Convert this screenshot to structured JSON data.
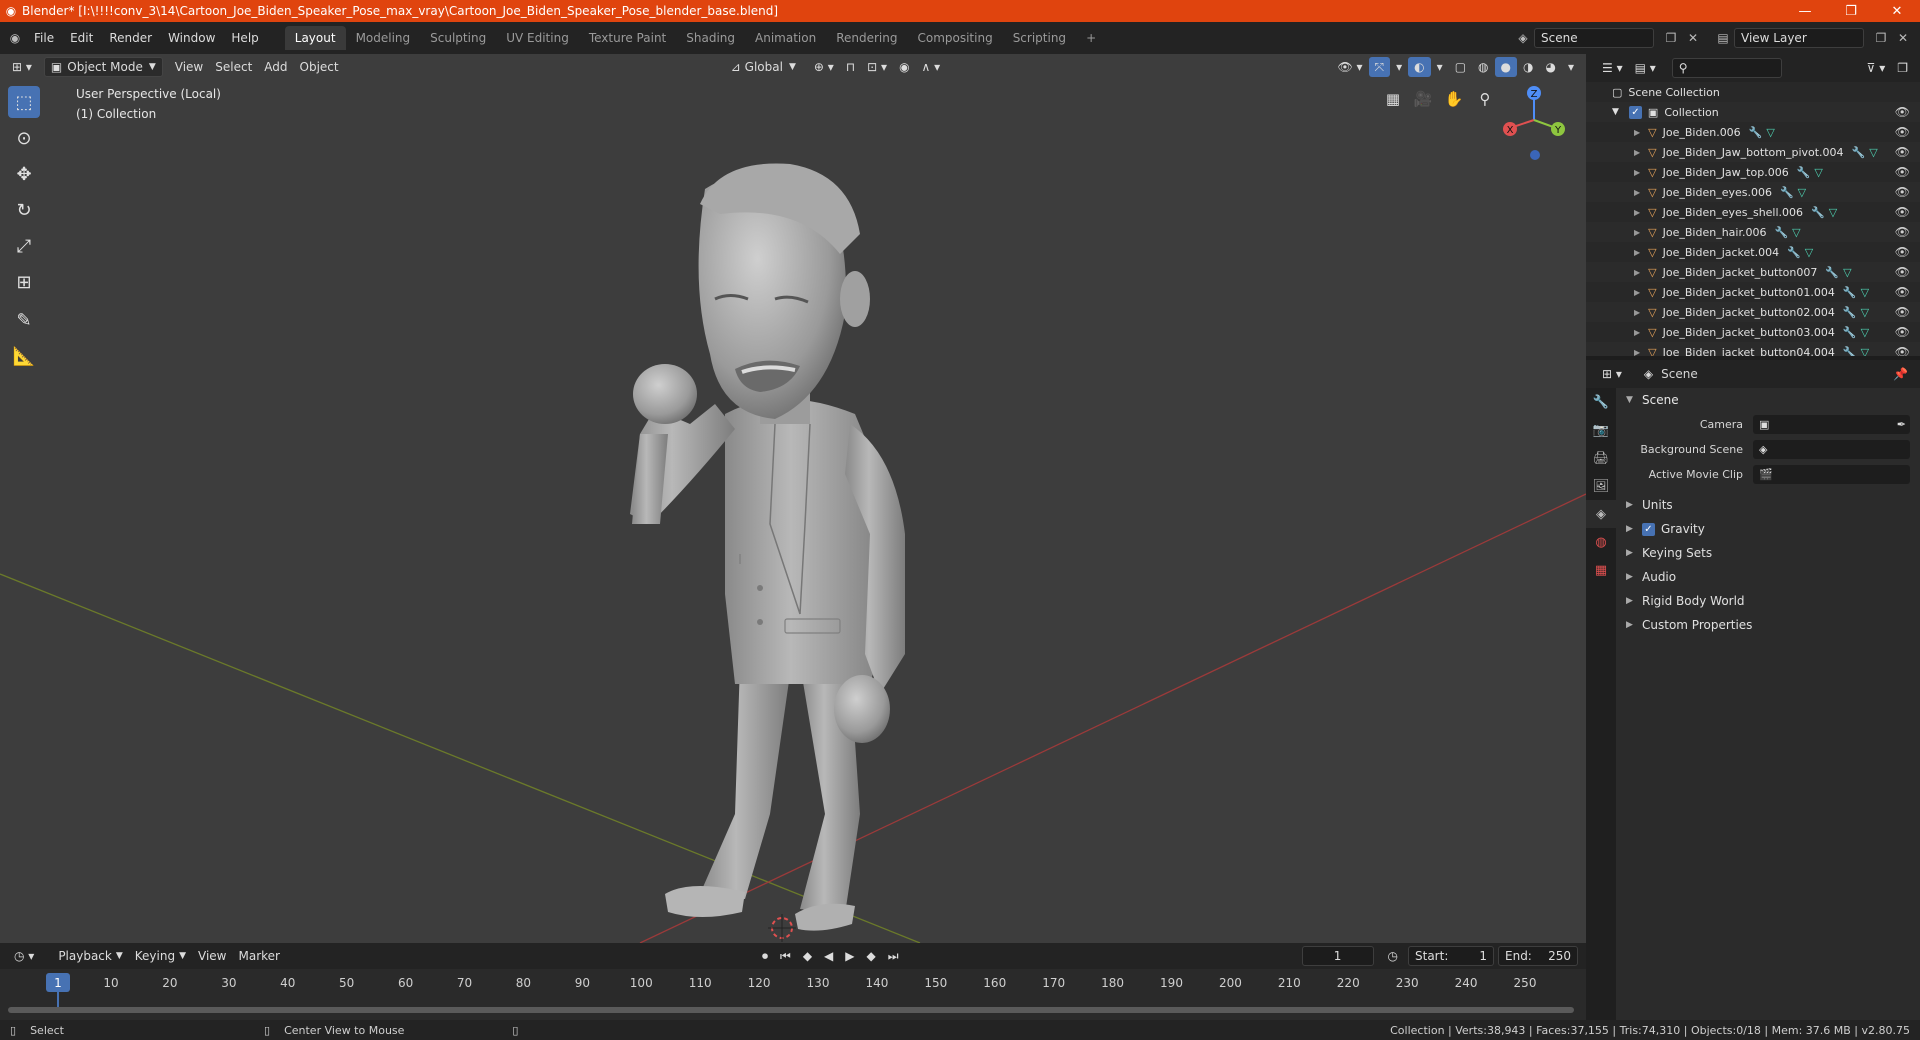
{
  "window": {
    "title": "Blender* [I:\\!!!!conv_3\\14\\Cartoon_Joe_Biden_Speaker_Pose_max_vray\\Cartoon_Joe_Biden_Speaker_Pose_blender_base.blend]",
    "minimize": "—",
    "maximize": "❐",
    "close": "✕"
  },
  "menus": [
    "File",
    "Edit",
    "Render",
    "Window",
    "Help"
  ],
  "workspaces": [
    "Layout",
    "Modeling",
    "Sculpting",
    "UV Editing",
    "Texture Paint",
    "Shading",
    "Animation",
    "Rendering",
    "Compositing",
    "Scripting",
    "+"
  ],
  "scene_selector": {
    "value": "Scene"
  },
  "view_layer_selector": {
    "value": "View Layer"
  },
  "viewport": {
    "mode": "Object Mode",
    "menus": [
      "View",
      "Select",
      "Add",
      "Object"
    ],
    "transform_orientation": "Global",
    "perspective_label": "User Perspective (Local)",
    "collection_label": "(1) Collection",
    "gizmo": {
      "x": "X",
      "y": "Y",
      "z": "Z"
    }
  },
  "timeline": {
    "menus": [
      "Playback",
      "Keying",
      "View",
      "Marker"
    ],
    "current_frame": "1",
    "start_label": "Start:",
    "start": "1",
    "end_label": "End:",
    "end": "250",
    "ticks": [
      "1",
      "10",
      "20",
      "30",
      "40",
      "50",
      "60",
      "70",
      "80",
      "90",
      "100",
      "110",
      "120",
      "130",
      "140",
      "150",
      "160",
      "170",
      "180",
      "190",
      "200",
      "210",
      "220",
      "230",
      "240",
      "250"
    ]
  },
  "outliner": {
    "scene_collection": "Scene Collection",
    "collection": "Collection",
    "objects": [
      "Joe_Biden.006",
      "Joe_Biden_Jaw_bottom_pivot.004",
      "Joe_Biden_Jaw_top.006",
      "Joe_Biden_eyes.006",
      "Joe_Biden_eyes_shell.006",
      "Joe_Biden_hair.006",
      "Joe_Biden_jacket.004",
      "Joe_Biden_jacket_button007",
      "Joe_Biden_jacket_button01.004",
      "Joe_Biden_jacket_button02.004",
      "Joe_Biden_jacket_button03.004",
      "Joe_Biden_jacket_button04.004"
    ]
  },
  "properties": {
    "context": "Scene",
    "panel": "Scene",
    "fields": [
      {
        "label": "Camera",
        "value": ""
      },
      {
        "label": "Background Scene",
        "value": ""
      },
      {
        "label": "Active Movie Clip",
        "value": ""
      }
    ],
    "sections": [
      "Units",
      "Gravity",
      "Keying Sets",
      "Audio",
      "Rigid Body World",
      "Custom Properties"
    ]
  },
  "statusbar": {
    "left_action": "Select",
    "middle_action": "Center View to Mouse",
    "stats": "Collection | Verts:38,943 | Faces:37,155 | Tris:74,310 | Objects:0/18 | Mem: 37.6 MB | v2.80.75"
  }
}
